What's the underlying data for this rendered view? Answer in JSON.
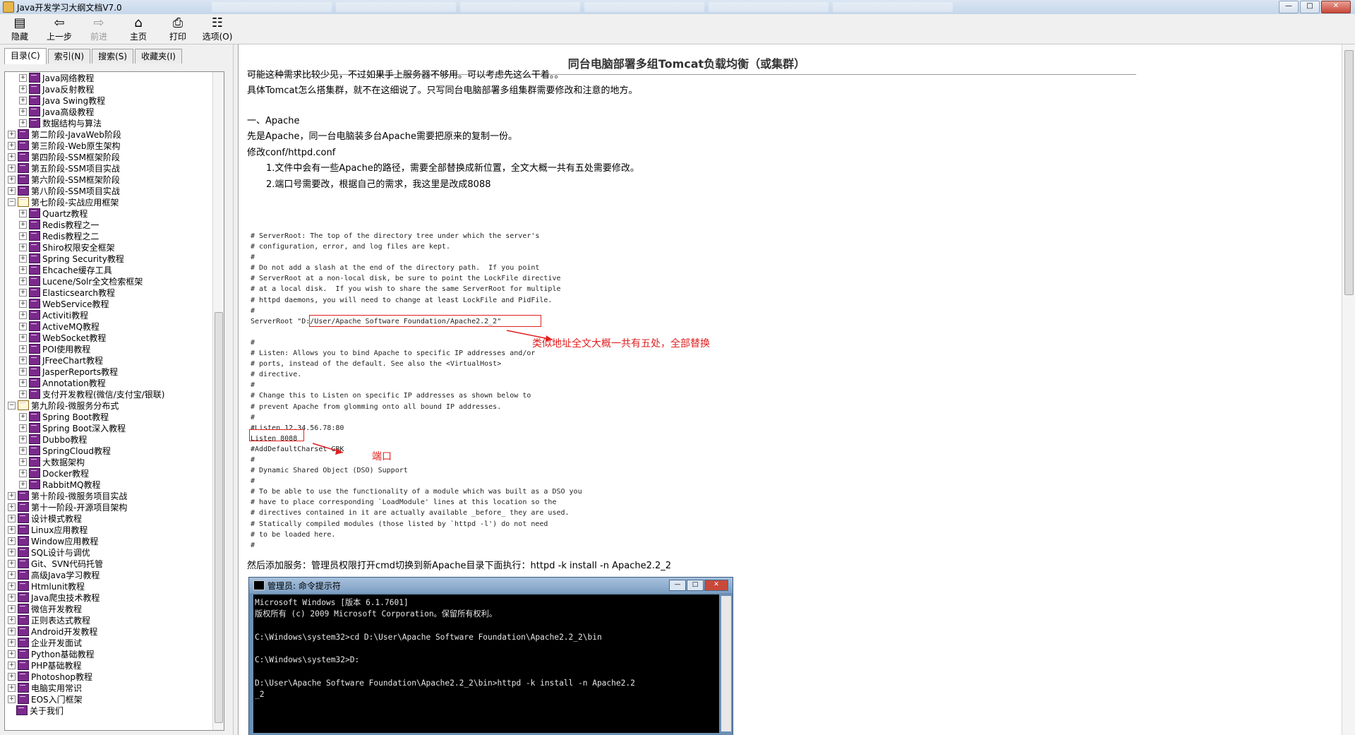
{
  "window": {
    "title": "Java开发学习大纲文档V7.0"
  },
  "window_buttons": {
    "minimize": "—",
    "maximize": "□",
    "close": "✕"
  },
  "toolbar": {
    "hide": "隐藏",
    "back": "上一步",
    "forward": "前进",
    "home": "主页",
    "print": "打印",
    "options": "选项(O)"
  },
  "tabs": [
    "目录(C)",
    "索引(N)",
    "搜索(S)",
    "收藏夹(I)"
  ],
  "tree": [
    {
      "label": "Java网络教程",
      "level": 2,
      "expander": "+"
    },
    {
      "label": "Java反射教程",
      "level": 2,
      "expander": "+"
    },
    {
      "label": "Java Swing教程",
      "level": 2,
      "expander": "+"
    },
    {
      "label": "Java高级教程",
      "level": 2,
      "expander": "+"
    },
    {
      "label": "数据结构与算法",
      "level": 2,
      "expander": "+"
    },
    {
      "label": "第二阶段-JavaWeb阶段",
      "level": 1,
      "expander": "+"
    },
    {
      "label": "第三阶段-Web原生架构",
      "level": 1,
      "expander": "+"
    },
    {
      "label": "第四阶段-SSM框架阶段",
      "level": 1,
      "expander": "+"
    },
    {
      "label": "第五阶段-SSM项目实战",
      "level": 1,
      "expander": "+"
    },
    {
      "label": "第六阶段-SSM框架阶段",
      "level": 1,
      "expander": "+"
    },
    {
      "label": "第八阶段-SSM项目实战",
      "level": 1,
      "expander": "+"
    },
    {
      "label": "第七阶段-实战应用框架",
      "level": 1,
      "expander": "−",
      "open": true
    },
    {
      "label": "Quartz教程",
      "level": 2,
      "expander": "+"
    },
    {
      "label": "Redis教程之一",
      "level": 2,
      "expander": "+"
    },
    {
      "label": "Redis教程之二",
      "level": 2,
      "expander": "+"
    },
    {
      "label": "Shiro权限安全框架",
      "level": 2,
      "expander": "+"
    },
    {
      "label": "Spring Security教程",
      "level": 2,
      "expander": "+"
    },
    {
      "label": "Ehcache缓存工具",
      "level": 2,
      "expander": "+"
    },
    {
      "label": "Lucene/Solr全文检索框架",
      "level": 2,
      "expander": "+"
    },
    {
      "label": "Elasticsearch教程",
      "level": 2,
      "expander": "+"
    },
    {
      "label": "WebService教程",
      "level": 2,
      "expander": "+"
    },
    {
      "label": "Activiti教程",
      "level": 2,
      "expander": "+"
    },
    {
      "label": "ActiveMQ教程",
      "level": 2,
      "expander": "+"
    },
    {
      "label": "WebSocket教程",
      "level": 2,
      "expander": "+"
    },
    {
      "label": "POI使用教程",
      "level": 2,
      "expander": "+"
    },
    {
      "label": "JFreeChart教程",
      "level": 2,
      "expander": "+"
    },
    {
      "label": "JasperReports教程",
      "level": 2,
      "expander": "+"
    },
    {
      "label": "Annotation教程",
      "level": 2,
      "expander": "+"
    },
    {
      "label": "支付开发教程(微信/支付宝/银联)",
      "level": 2,
      "expander": "+"
    },
    {
      "label": "第九阶段-微服务分布式",
      "level": 1,
      "expander": "−",
      "open": true
    },
    {
      "label": "Spring Boot教程",
      "level": 2,
      "expander": "+"
    },
    {
      "label": "Spring Boot深入教程",
      "level": 2,
      "expander": "+"
    },
    {
      "label": "Dubbo教程",
      "level": 2,
      "expander": "+"
    },
    {
      "label": "SpringCloud教程",
      "level": 2,
      "expander": "+"
    },
    {
      "label": "大数据架构",
      "level": 2,
      "expander": "+"
    },
    {
      "label": "Docker教程",
      "level": 2,
      "expander": "+"
    },
    {
      "label": "RabbitMQ教程",
      "level": 2,
      "expander": "+"
    },
    {
      "label": "第十阶段-微服务项目实战",
      "level": 1,
      "expander": "+"
    },
    {
      "label": "第十一阶段-开源项目架构",
      "level": 1,
      "expander": "+"
    },
    {
      "label": "设计模式教程",
      "level": 1,
      "expander": "+"
    },
    {
      "label": "Linux应用教程",
      "level": 1,
      "expander": "+"
    },
    {
      "label": "Window应用教程",
      "level": 1,
      "expander": "+"
    },
    {
      "label": "SQL设计与调优",
      "level": 1,
      "expander": "+"
    },
    {
      "label": "Git、SVN代码托管",
      "level": 1,
      "expander": "+"
    },
    {
      "label": "高级Java学习教程",
      "level": 1,
      "expander": "+"
    },
    {
      "label": "Htmlunit教程",
      "level": 1,
      "expander": "+"
    },
    {
      "label": "Java爬虫技术教程",
      "level": 1,
      "expander": "+"
    },
    {
      "label": "微信开发教程",
      "level": 1,
      "expander": "+"
    },
    {
      "label": "正则表达式教程",
      "level": 1,
      "expander": "+"
    },
    {
      "label": "Android开发教程",
      "level": 1,
      "expander": "+"
    },
    {
      "label": "企业开发面试",
      "level": 1,
      "expander": "+"
    },
    {
      "label": "Python基础教程",
      "level": 1,
      "expander": "+"
    },
    {
      "label": "PHP基础教程",
      "level": 1,
      "expander": "+"
    },
    {
      "label": "Photoshop教程",
      "level": 1,
      "expander": "+"
    },
    {
      "label": "电脑实用常识",
      "level": 1,
      "expander": "+"
    },
    {
      "label": "EOS入门框架",
      "level": 1,
      "expander": "+"
    },
    {
      "label": "关于我们",
      "level": 1,
      "expander": ""
    }
  ],
  "article": {
    "title": "同台电脑部署多组Tomcat负载均衡（或集群）",
    "p1": "可能这种需求比较少见，不过如果手上服务器不够用。可以考虑先这么干着。。",
    "p2": "具体Tomcat怎么搭集群，就不在这细说了。只写同台电脑部署多组集群需要修改和注意的地方。",
    "section": "一、Apache",
    "p3": "先是Apache，同一台电脑装多台Apache需要把原来的复制一份。",
    "p4": "修改conf/httpd.conf",
    "p5": "1.文件中会有一些Apache的路径，需要全部替换成新位置，全文大概一共有五处需要修改。",
    "p6": "2.端口号需要改，根据自己的需求，我这里是改成8088",
    "code": "# ServerRoot: The top of the directory tree under which the server's\n# configuration, error, and log files are kept.\n#\n# Do not add a slash at the end of the directory path.  If you point\n# ServerRoot at a non-local disk, be sure to point the LockFile directive\n# at a local disk.  If you wish to share the same ServerRoot for multiple\n# httpd daemons, you will need to change at least LockFile and PidFile.\n#\nServerRoot \"D:/User/Apache Software Foundation/Apache2.2_2\"\n\n#\n# Listen: Allows you to bind Apache to specific IP addresses and/or\n# ports, instead of the default. See also the <VirtualHost>\n# directive.\n#\n# Change this to Listen on specific IP addresses as shown below to\n# prevent Apache from glomming onto all bound IP addresses.\n#\n#Listen 12.34.56.78:80\nListen 8088\n#AddDefaultCharset GBK\n#\n# Dynamic Shared Object (DSO) Support\n#\n# To be able to use the functionality of a module which was built as a DSO you\n# have to place corresponding `LoadModule' lines at this location so the\n# directives contained in it are actually available _before_ they are used.\n# Statically compiled modules (those listed by `httpd -l') do not need\n# to be loaded here.\n#",
    "annot_path": "类似地址全文大概一共有五处，全部替换",
    "annot_port": "端口",
    "p7": "然后添加服务：管理员权限打开cmd切换到新Apache目录下面执行：httpd -k install -n Apache2.2_2"
  },
  "cmd": {
    "title": "管理员: 命令提示符",
    "text": "Microsoft Windows [版本 6.1.7601]\n版权所有 (c) 2009 Microsoft Corporation。保留所有权利。\n\nC:\\Windows\\system32>cd D:\\User\\Apache Software Foundation\\Apache2.2_2\\bin\n\nC:\\Windows\\system32>D:\n\nD:\\User\\Apache Software Foundation\\Apache2.2_2\\bin>httpd -k install -n Apache2.2\n_2"
  },
  "colors": {
    "annotation": "#e02020",
    "tree_icon": "#7b2a8c"
  }
}
